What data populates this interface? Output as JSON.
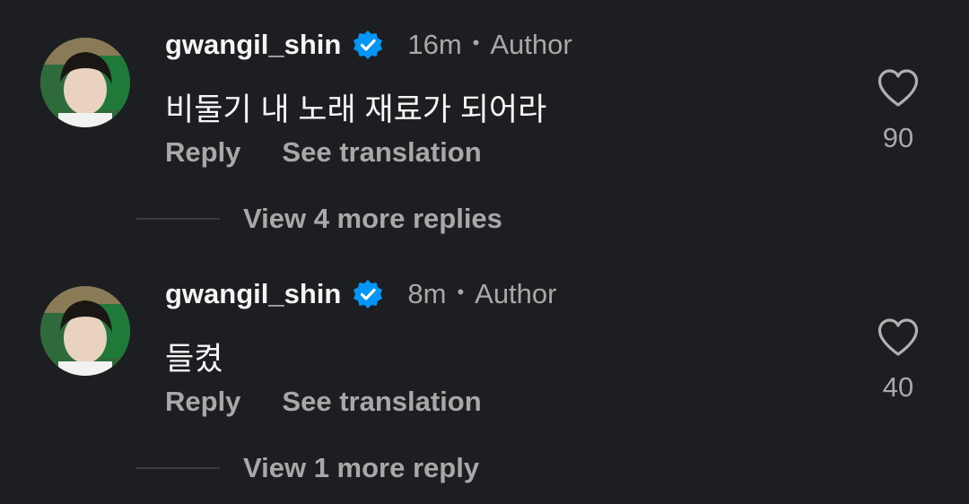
{
  "comments": [
    {
      "username": "gwangil_shin",
      "verified_icon": "verified-badge-icon",
      "time": "16m",
      "role": "Author",
      "text": "비둘기 내 노래 재료가 되어라",
      "reply_label": "Reply",
      "translate_label": "See translation",
      "likes": "90",
      "view_replies": "View 4 more replies"
    },
    {
      "username": "gwangil_shin",
      "verified_icon": "verified-badge-icon",
      "time": "8m",
      "role": "Author",
      "text": "들켰",
      "reply_label": "Reply",
      "translate_label": "See translation",
      "likes": "40",
      "view_replies": "View 1 more reply"
    }
  ],
  "colors": {
    "background": "#1c1e21",
    "primary_text": "#f5f5f5",
    "secondary_text": "#a8a8a8",
    "verified_blue": "#0095f6"
  }
}
